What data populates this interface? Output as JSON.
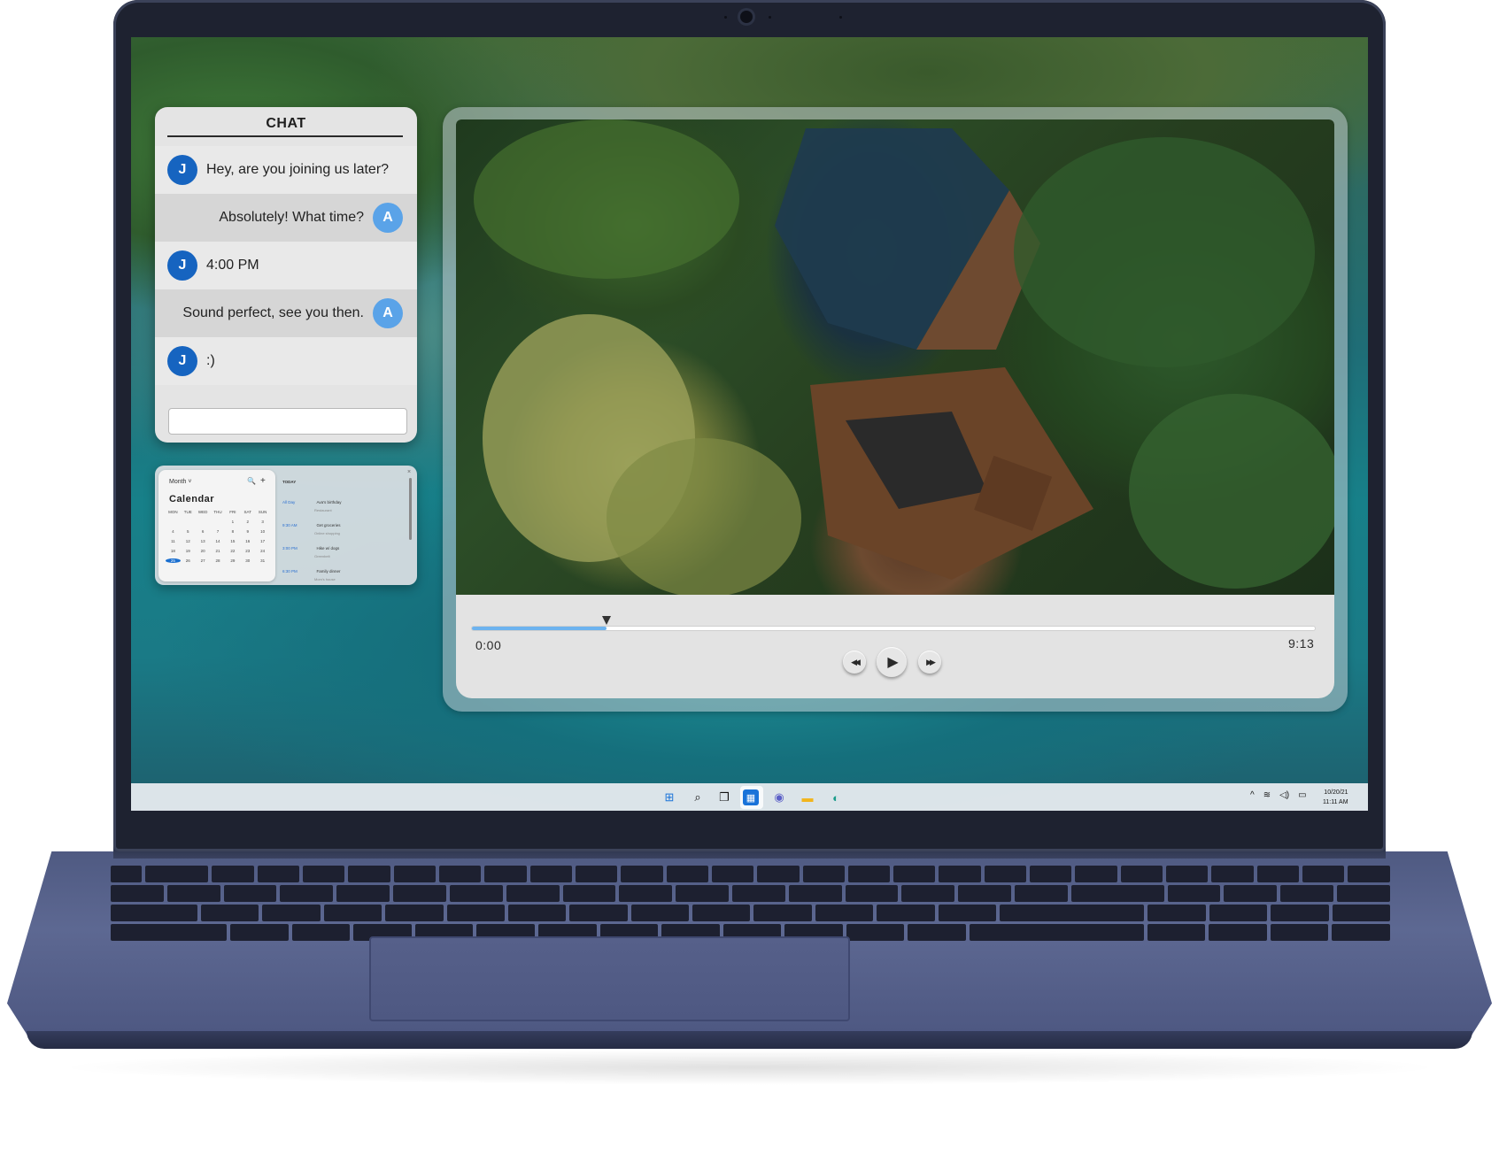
{
  "chat": {
    "title": "CHAT",
    "messages": [
      {
        "sender": "J",
        "text": "Hey, are you joining us later?",
        "direction": "incoming"
      },
      {
        "sender": "A",
        "text": "Absolutely! What time?",
        "direction": "outgoing"
      },
      {
        "sender": "J",
        "text": "4:00 PM",
        "direction": "incoming"
      },
      {
        "sender": "A",
        "text": "Sound perfect, see you then.",
        "direction": "outgoing"
      },
      {
        "sender": "J",
        "text": ":)",
        "direction": "incoming"
      }
    ],
    "input_value": ""
  },
  "calendar": {
    "view_selector": "Month ˅",
    "title": "Calendar",
    "weekdays": [
      "MON",
      "TUE",
      "WED",
      "THU",
      "FRI",
      "SAT",
      "SUN"
    ],
    "days": [
      "",
      "",
      "",
      "",
      "",
      "",
      ""
    ],
    "selected_day": "25",
    "today_label": "TODAY",
    "events": [
      {
        "time": "All Day",
        "title": "Ava's birthday",
        "subtitle": "Restaurant"
      },
      {
        "time": "9:30 AM",
        "title": "Get groceries",
        "subtitle": "Online shopping"
      },
      {
        "time": "3:00 PM",
        "title": "Hike w/ dogs",
        "subtitle": "Greenbelt"
      },
      {
        "time": "6:30 PM",
        "title": "Family dinner",
        "subtitle": "Mom's house"
      }
    ],
    "close_glyph": "×",
    "search_glyph": "🔍",
    "add_glyph": "+"
  },
  "player": {
    "current_time": "0:00",
    "duration": "9:13",
    "progress_fraction": 0.16,
    "rewind_glyph": "◀◀",
    "play_glyph": "▶",
    "forward_glyph": "▶▶"
  },
  "taskbar": {
    "icons": [
      "windows-start-icon",
      "search-icon",
      "task-view-icon",
      "widgets-icon",
      "teams-chat-icon",
      "file-explorer-icon",
      "edge-browser-icon"
    ],
    "start_glyph": "⊞",
    "search_glyph": "⌕",
    "taskview_glyph": "❐",
    "widgets_glyph": "▦",
    "chat_glyph": "◉",
    "explorer_glyph": "▬",
    "edge_glyph": "◐",
    "tray": {
      "chevron": "^",
      "wifi": "≋",
      "volume": "◁)",
      "battery": "▭"
    },
    "date": "10/20/21",
    "time": "11:11 AM"
  },
  "colors": {
    "bezel": "#1e2230",
    "chassis": "#565f8a",
    "accent_blue": "#1664c0",
    "avatar_light_blue": "#5aa3e8",
    "progress_blue": "#6db3ef"
  }
}
